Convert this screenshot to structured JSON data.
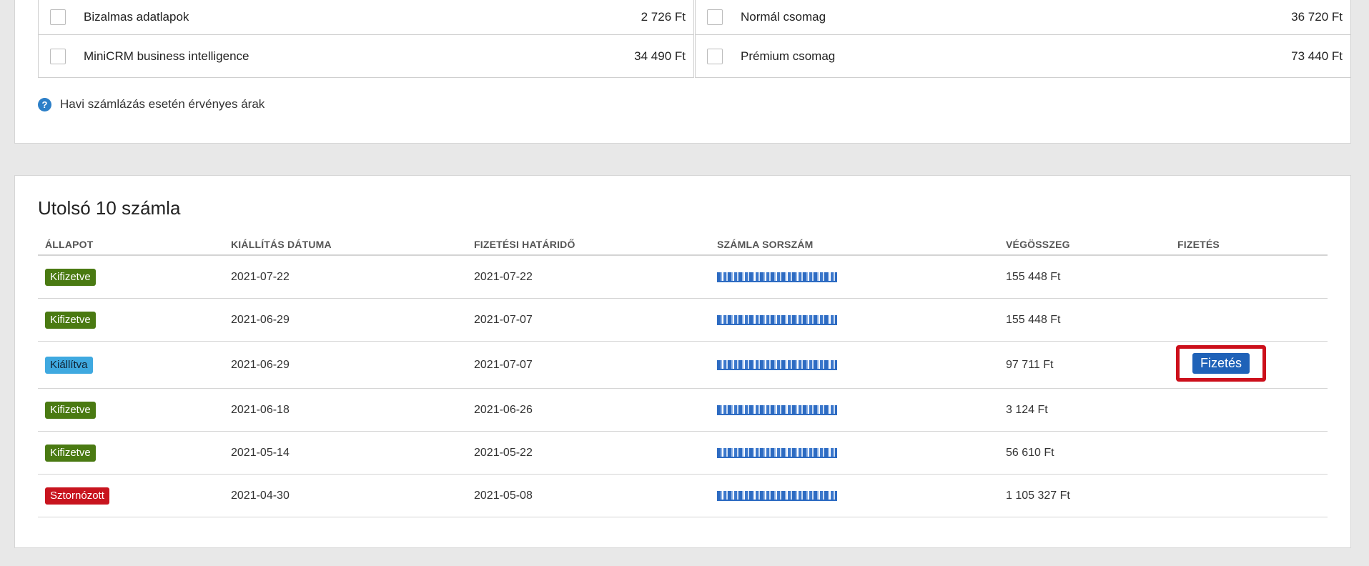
{
  "packages": {
    "left": [
      {
        "name": "Bizalmas adatlapok",
        "price": "2 726 Ft"
      },
      {
        "name": "MiniCRM business intelligence",
        "price": "34 490 Ft"
      }
    ],
    "right": [
      {
        "name": "Normál csomag",
        "price": "36 720 Ft"
      },
      {
        "name": "Prémium csomag",
        "price": "73 440 Ft"
      }
    ]
  },
  "note": {
    "icon": "help-icon",
    "text": "Havi számlázás esetén érvényes árak"
  },
  "invoices": {
    "title": "Utolsó 10 számla",
    "headers": {
      "status": "ÁLLAPOT",
      "issue_date": "KIÁLLÍTÁS DÁTUMA",
      "due_date": "FIZETÉSI HATÁRIDŐ",
      "number": "SZÁMLA SORSZÁM",
      "total": "VÉGÖSSZEG",
      "payment": "FIZETÉS"
    },
    "rows": [
      {
        "status": "Kifizetve",
        "issue_date": "2021-07-22",
        "due_date": "2021-07-22",
        "total": "155 448 Ft"
      },
      {
        "status": "Kifizetve",
        "issue_date": "2021-06-29",
        "due_date": "2021-07-07",
        "total": "155 448 Ft"
      },
      {
        "status": "Kiállítva",
        "issue_date": "2021-06-29",
        "due_date": "2021-07-07",
        "total": "97 711 Ft",
        "pay_label": "Fizetés"
      },
      {
        "status": "Kifizetve",
        "issue_date": "2021-06-18",
        "due_date": "2021-06-26",
        "total": "3 124 Ft"
      },
      {
        "status": "Kifizetve",
        "issue_date": "2021-05-14",
        "due_date": "2021-05-22",
        "total": "56 610 Ft"
      },
      {
        "status": "Sztornózott",
        "issue_date": "2021-04-30",
        "due_date": "2021-05-08",
        "total": "1 105 327 Ft"
      }
    ]
  },
  "colors": {
    "paid": "#4a7a12",
    "issued": "#3fa9e0",
    "storno": "#c8141e",
    "pay_button": "#1f62b8",
    "highlight": "#cc0f1b"
  }
}
